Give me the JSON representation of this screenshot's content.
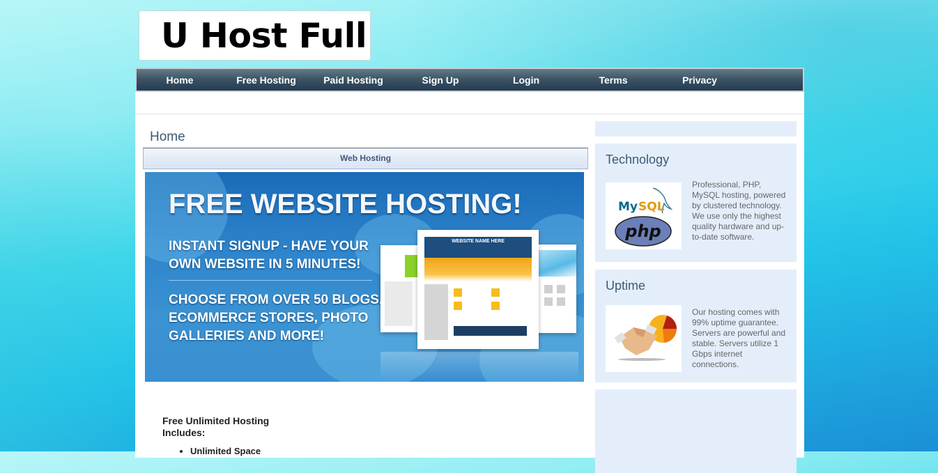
{
  "site": {
    "logo_text": "U Host Full"
  },
  "nav": {
    "items": [
      {
        "label": "Home"
      },
      {
        "label": "Free Hosting"
      },
      {
        "label": "Paid Hosting"
      },
      {
        "label": "Sign Up"
      },
      {
        "label": "Login"
      },
      {
        "label": "Terms"
      },
      {
        "label": "Privacy"
      }
    ]
  },
  "main": {
    "breadcrumb": "Home",
    "section_title": "Web Hosting",
    "banner": {
      "headline": "FREE WEBSITE HOSTING!",
      "line1": "INSTANT SIGNUP - HAVE YOUR",
      "line2": "OWN WEBSITE IN 5 MINUTES!",
      "line3": "CHOOSE FROM OVER 50 BLOGS,",
      "line4": "ECOMMERCE STORES, PHOTO",
      "line5": "GALLERIES AND MORE!",
      "mock_site_title": "WEBSITE NAME HERE"
    },
    "features_title": "Free Unlimited Hosting Includes:",
    "features": [
      "Unlimited Space"
    ]
  },
  "sidebar": {
    "cards": [
      {
        "title": "Technology",
        "image": "mysql-php-logos",
        "text": "Professional, PHP, MySQL hosting, powered by clustered technology. We use only the highest quality hardware and up-to-date software."
      },
      {
        "title": "Uptime",
        "image": "handshake-pie-chart",
        "text": "Our hosting comes with 99% uptime guarantee. Servers are powerful and stable. Servers utilize 1 Gbps internet connections."
      }
    ],
    "logo_labels": {
      "mysql": "MySQL",
      "php": "php"
    }
  },
  "colors": {
    "nav_dark": "#243a52",
    "heading_blue": "#3e5a74",
    "sidebar_bg": "#e4eefb",
    "banner_blue": "#2f86cc"
  }
}
